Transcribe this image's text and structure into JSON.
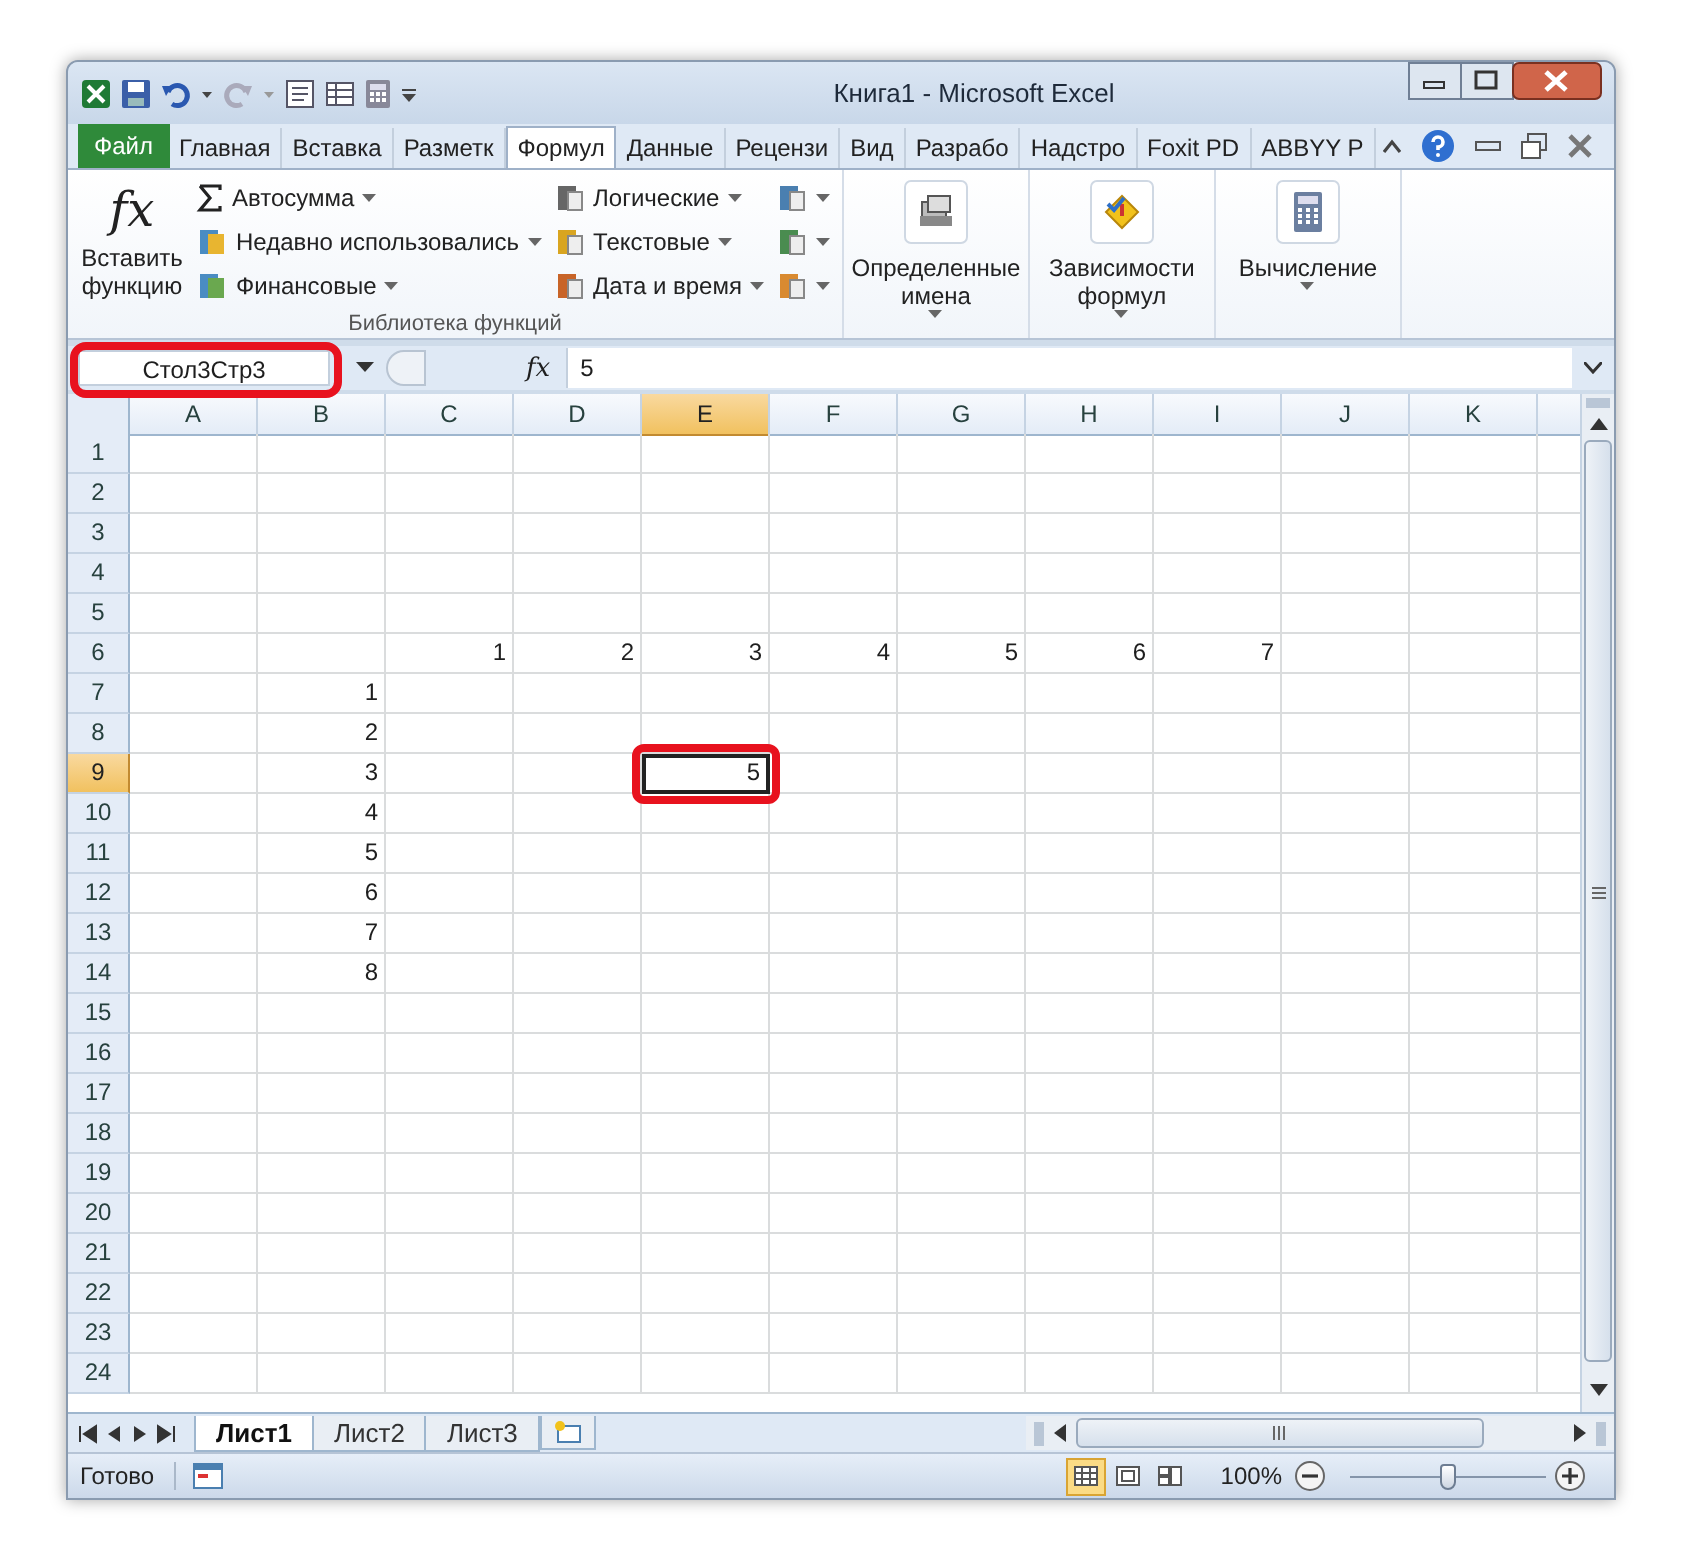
{
  "title_bar": {
    "title": "Книга1 - Microsoft Excel"
  },
  "ribbon_tabs": [
    {
      "label": "Файл",
      "kind": "file",
      "selected": false
    },
    {
      "label": "Главная",
      "kind": "tab",
      "selected": false
    },
    {
      "label": "Вставка",
      "kind": "tab",
      "selected": false
    },
    {
      "label": "Разметк",
      "kind": "tab",
      "selected": false
    },
    {
      "label": "Формул",
      "kind": "tab",
      "selected": true
    },
    {
      "label": "Данные",
      "kind": "tab",
      "selected": false
    },
    {
      "label": "Рецензи",
      "kind": "tab",
      "selected": false
    },
    {
      "label": "Вид",
      "kind": "tab",
      "selected": false
    },
    {
      "label": "Разрабо",
      "kind": "tab",
      "selected": false
    },
    {
      "label": "Надстро",
      "kind": "tab",
      "selected": false
    },
    {
      "label": "Foxit PD",
      "kind": "tab",
      "selected": false
    },
    {
      "label": "ABBYY P",
      "kind": "tab",
      "selected": false
    }
  ],
  "function_library": {
    "icon": "fx",
    "insert_function": "Вставить функцию",
    "group_label": "Библиотека функций",
    "column_1": [
      "Автосумма",
      "Недавно использовались",
      "Финансовые"
    ],
    "column_2": [
      "Логические",
      "Текстовые",
      "Дата и время"
    ]
  },
  "big_buttons": [
    {
      "label": "Определенные имена",
      "kind": "names"
    },
    {
      "label": "Зависимости формул",
      "kind": "audit"
    },
    {
      "label": "Вычисление",
      "kind": "calc"
    }
  ],
  "formula_bar": {
    "fx_label": "fx",
    "name_box": "Стол3Стр3",
    "name_box_highlighted": true,
    "value": "5"
  },
  "columns": [
    {
      "label": "A",
      "selected": false
    },
    {
      "label": "B",
      "selected": false
    },
    {
      "label": "C",
      "selected": false
    },
    {
      "label": "D",
      "selected": false
    },
    {
      "label": "E",
      "selected": true
    },
    {
      "label": "F",
      "selected": false
    },
    {
      "label": "G",
      "selected": false
    },
    {
      "label": "H",
      "selected": false
    },
    {
      "label": "I",
      "selected": false
    },
    {
      "label": "J",
      "selected": false
    },
    {
      "label": "K",
      "selected": false
    }
  ],
  "rows": [
    {
      "label": "1",
      "selected": false,
      "cells": {}
    },
    {
      "label": "2",
      "selected": false,
      "cells": {}
    },
    {
      "label": "3",
      "selected": false,
      "cells": {}
    },
    {
      "label": "4",
      "selected": false,
      "cells": {}
    },
    {
      "label": "5",
      "selected": false,
      "cells": {}
    },
    {
      "label": "6",
      "selected": false,
      "cells": {
        "C": {
          "text": "1",
          "selected": false
        },
        "D": {
          "text": "2",
          "selected": false
        },
        "E": {
          "text": "3",
          "selected": false
        },
        "F": {
          "text": "4",
          "selected": false
        },
        "G": {
          "text": "5",
          "selected": false
        },
        "H": {
          "text": "6",
          "selected": false
        },
        "I": {
          "text": "7",
          "selected": false
        }
      }
    },
    {
      "label": "7",
      "selected": false,
      "cells": {
        "B": {
          "text": "1",
          "selected": false
        }
      }
    },
    {
      "label": "8",
      "selected": false,
      "cells": {
        "B": {
          "text": "2",
          "selected": false
        }
      }
    },
    {
      "label": "9",
      "selected": true,
      "cells": {
        "B": {
          "text": "3",
          "selected": false
        },
        "E": {
          "text": "5",
          "selected": true,
          "highlighted": true
        }
      }
    },
    {
      "label": "10",
      "selected": false,
      "cells": {
        "B": {
          "text": "4",
          "selected": false
        }
      }
    },
    {
      "label": "11",
      "selected": false,
      "cells": {
        "B": {
          "text": "5",
          "selected": false
        }
      }
    },
    {
      "label": "12",
      "selected": false,
      "cells": {
        "B": {
          "text": "6",
          "selected": false
        }
      }
    },
    {
      "label": "13",
      "selected": false,
      "cells": {
        "B": {
          "text": "7",
          "selected": false
        }
      }
    },
    {
      "label": "14",
      "selected": false,
      "cells": {
        "B": {
          "text": "8",
          "selected": false
        }
      }
    },
    {
      "label": "15",
      "selected": false,
      "cells": {}
    },
    {
      "label": "16",
      "selected": false,
      "cells": {}
    },
    {
      "label": "17",
      "selected": false,
      "cells": {}
    },
    {
      "label": "18",
      "selected": false,
      "cells": {}
    },
    {
      "label": "19",
      "selected": false,
      "cells": {}
    },
    {
      "label": "20",
      "selected": false,
      "cells": {}
    },
    {
      "label": "21",
      "selected": false,
      "cells": {}
    },
    {
      "label": "22",
      "selected": false,
      "cells": {}
    },
    {
      "label": "23",
      "selected": false,
      "cells": {}
    },
    {
      "label": "24",
      "selected": false,
      "cells": {}
    }
  ],
  "sheets": [
    {
      "label": "Лист1",
      "selected": true
    },
    {
      "label": "Лист2",
      "selected": false
    },
    {
      "label": "Лист3",
      "selected": false
    }
  ],
  "status_bar": {
    "status": "Готово",
    "views": [
      {
        "kind": "normal",
        "selected": true
      },
      {
        "kind": "layout",
        "selected": false
      },
      {
        "kind": "pagebreak",
        "selected": false
      }
    ],
    "zoom": "100%",
    "zoom_slider": {
      "level": 0.5
    }
  }
}
